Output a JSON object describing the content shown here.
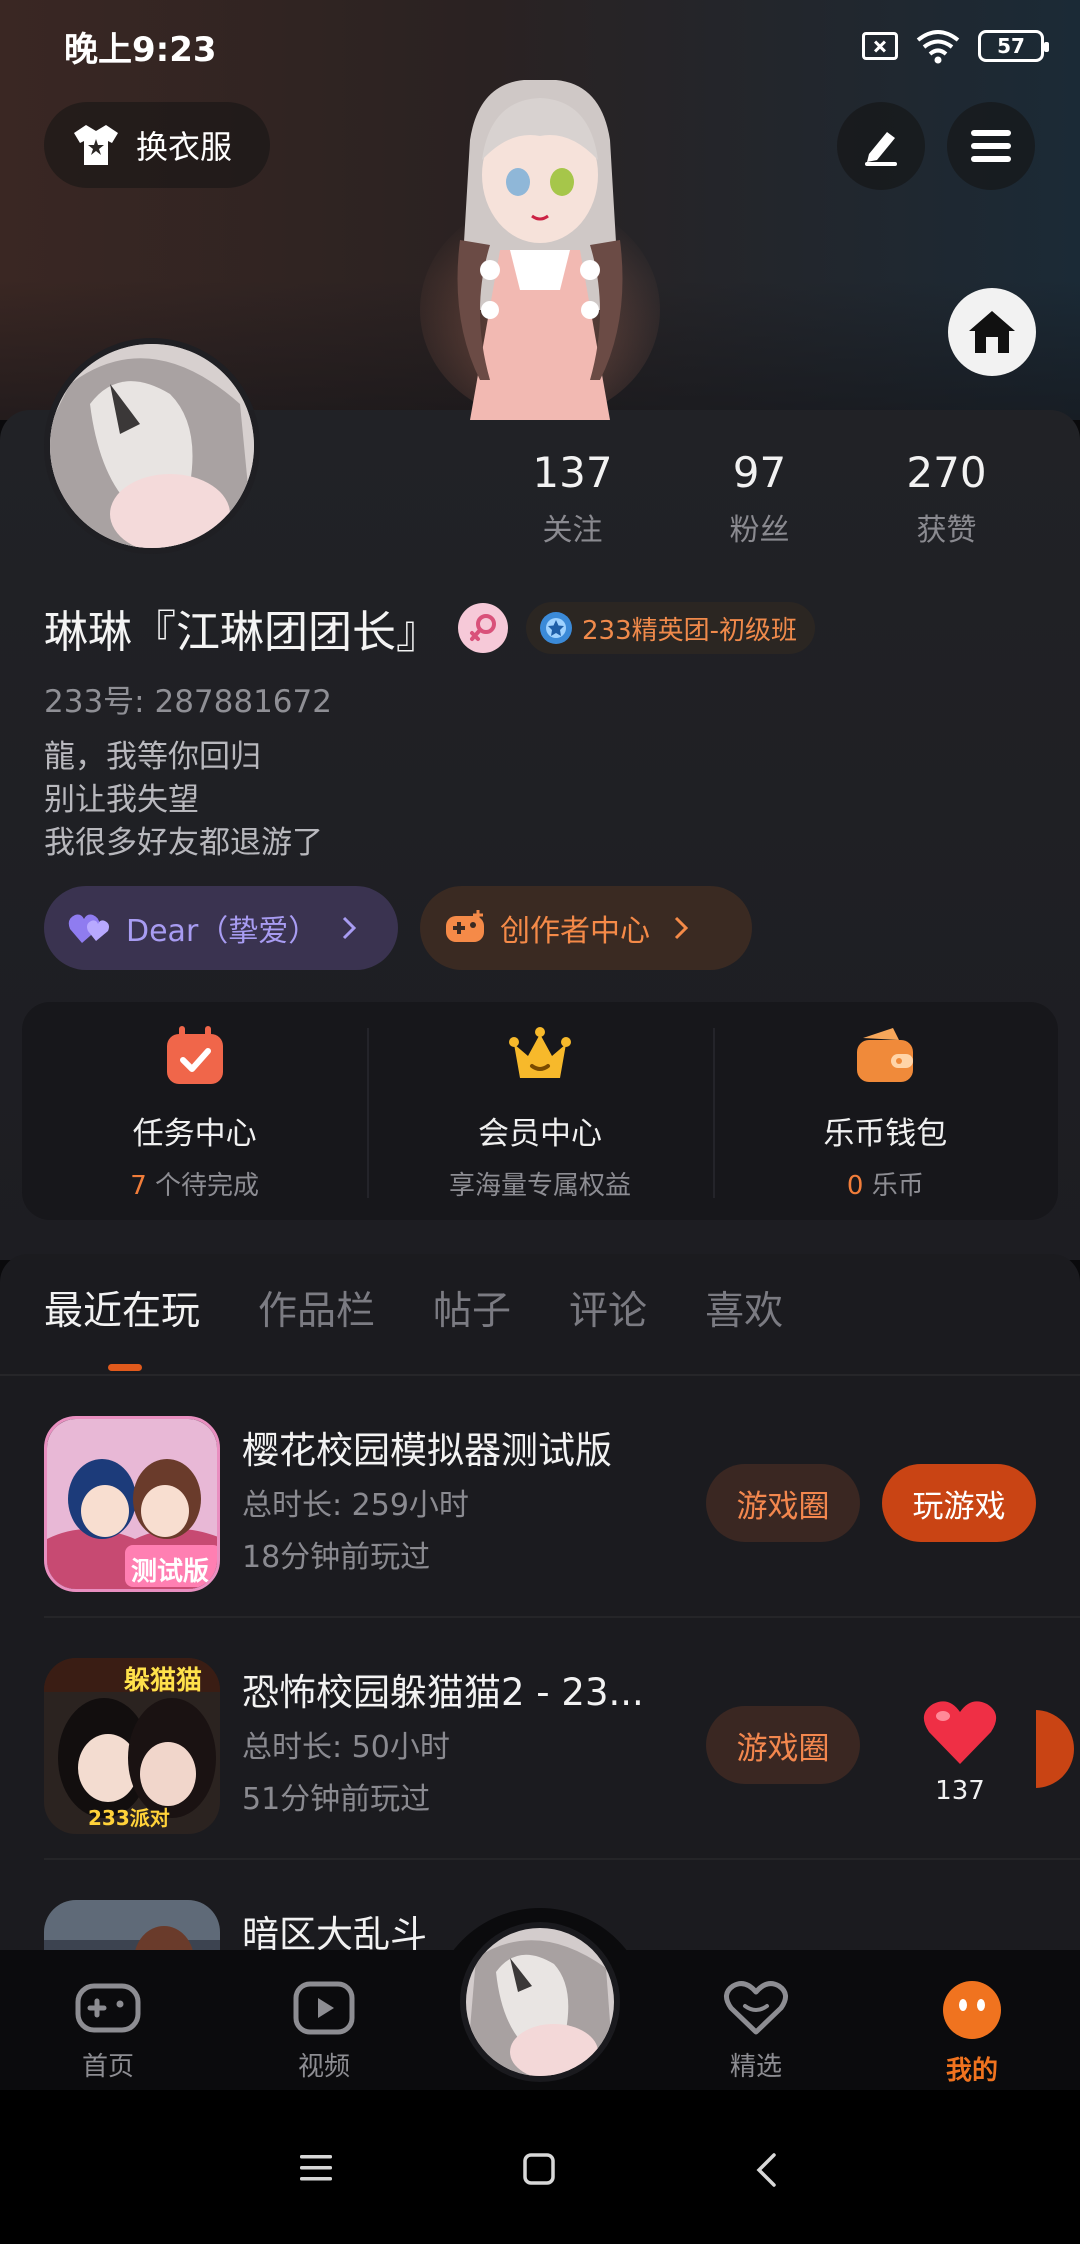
{
  "status_bar": {
    "time": "晚上9:23",
    "battery": "57"
  },
  "top": {
    "dress_label": "换衣服"
  },
  "stats": [
    {
      "num": "137",
      "label": "关注"
    },
    {
      "num": "97",
      "label": "粉丝"
    },
    {
      "num": "270",
      "label": "获赞"
    }
  ],
  "profile": {
    "name": "琳琳『江琳团团长』",
    "badge": "233精英团-初级班",
    "uid": "233号: 287881672",
    "bio_lines": [
      "龍，我等你回归",
      "别让我失望",
      "我很多好友都退游了"
    ]
  },
  "pills": {
    "dear": "Dear（挚爱）",
    "creator": "创作者中心"
  },
  "features": [
    {
      "title": "任务中心",
      "sub_num": "7",
      "sub_text": " 个待完成",
      "icon": "calendar-check-icon"
    },
    {
      "title": "会员中心",
      "sub_num": "",
      "sub_text": "享海量专属权益",
      "icon": "crown-icon"
    },
    {
      "title": "乐币钱包",
      "sub_num": "0",
      "sub_text": " 乐币",
      "icon": "wallet-icon"
    }
  ],
  "tabs": [
    "最近在玩",
    "作品栏",
    "帖子",
    "评论",
    "喜欢"
  ],
  "games": [
    {
      "title": "樱花校园模拟器测试版",
      "duration": "总时长: 259小时",
      "last": "18分钟前玩过",
      "thumb_text": "测试版"
    },
    {
      "title": "恐怖校园躲猫猫2 - 23...",
      "duration": "总时长: 50小时",
      "last": "51分钟前玩过",
      "thumb_text": "躲猫猫",
      "thumb_text2": "233派对"
    },
    {
      "title": "暗区大乱斗",
      "duration": "",
      "last": ""
    }
  ],
  "buttons": {
    "circle": "游戏圈",
    "play": "玩游戏"
  },
  "heart_count": "137",
  "nav": [
    "首页",
    "视频",
    "精选",
    "我的"
  ],
  "colors": {
    "accent": "#f0731f",
    "play_button": "#c94414",
    "dear": "#a89cf2"
  }
}
